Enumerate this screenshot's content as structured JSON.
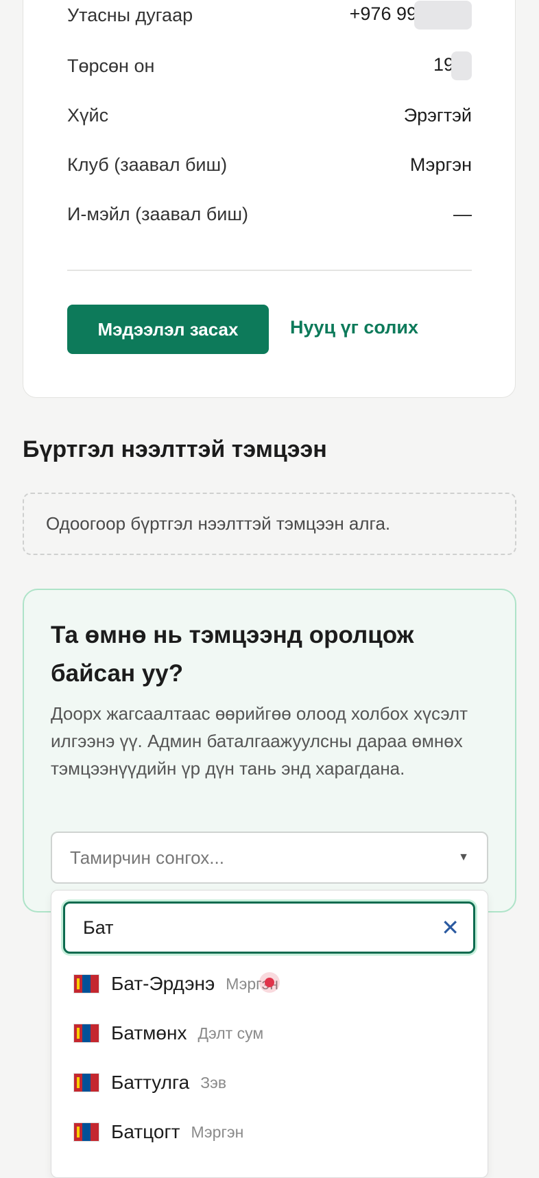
{
  "profile": {
    "rows": [
      {
        "label": "Утасны дугаар",
        "value": "+976 99"
      },
      {
        "label": "Төрсөн он",
        "value": "19"
      },
      {
        "label": "Хүйс",
        "value": "Эрэгтэй"
      },
      {
        "label": "Клуб (заавал биш)",
        "value": "Мэргэн"
      },
      {
        "label": "И-мэйл (заавал биш)",
        "value": "—"
      }
    ],
    "edit_button": "Мэдээлэл засах",
    "password_link": "Нууц үг солих"
  },
  "registrations": {
    "title": "Бүртгэл нээлттэй тэмцээн",
    "empty_text": "Одоогоор бүртгэл нээлттэй тэмцээн алга."
  },
  "claim": {
    "title": "Та өмнө нь тэмцээнд оролцож байсан уу?",
    "description": "Доорх жагсаалтаас өөрийгөө олоод холбох хүсэлт илгээнэ үү. Админ баталгаажуулсны дараа өмнөх тэмцээнүүдийн үр дүн тань энд харагдана.",
    "select_placeholder": "Тамирчин сонгох...",
    "caret": "▼",
    "search_value": "Бат",
    "clear_icon": "✕",
    "options": [
      {
        "name": "Бат-Эрдэнэ",
        "club": "Мэргэн"
      },
      {
        "name": "Батмөнх",
        "club": "Дэлт сум"
      },
      {
        "name": "Баттулга",
        "club": "Зэв"
      },
      {
        "name": "Батцогт",
        "club": "Мэргэн"
      }
    ]
  },
  "colors": {
    "primary": "#0d7a5a",
    "claim_bg": "#f1f8f4",
    "claim_border": "#aee3c8",
    "clear_icon": "#2b5aa0"
  },
  "icons": {
    "flag": "mongolia-flag-icon",
    "caret": "chevron-down-icon",
    "clear": "close-icon"
  }
}
